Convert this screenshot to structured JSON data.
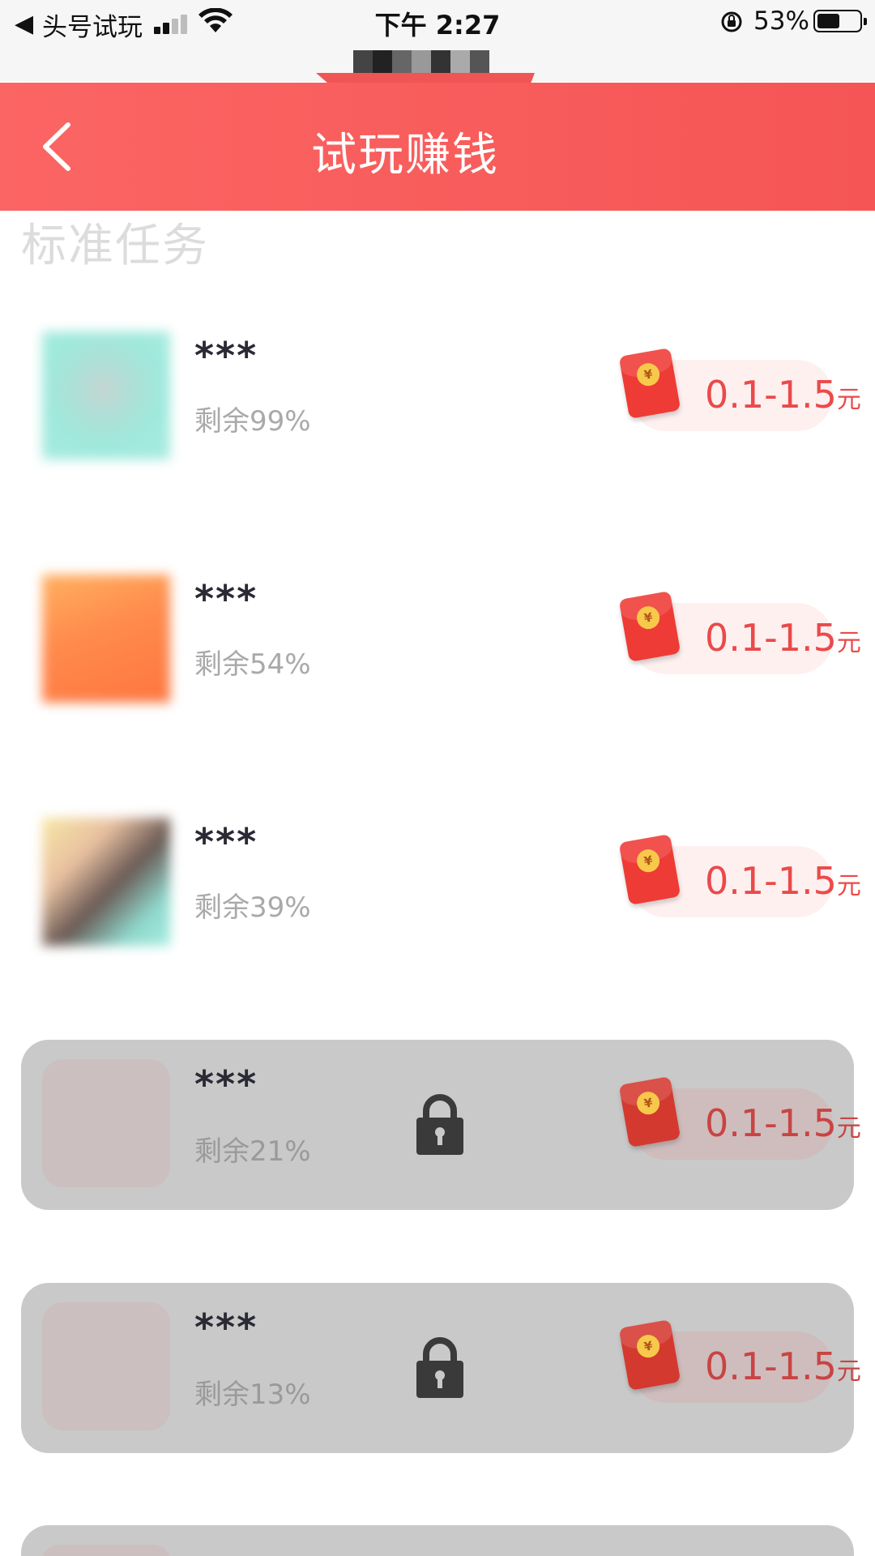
{
  "status_bar": {
    "back_glyph": "◀",
    "carrier": "头号试玩",
    "time": "下午 2:27",
    "battery_percent": "53%",
    "battery_level": 0.53,
    "icons": [
      "signal-icon",
      "wifi-icon",
      "orientation-lock-icon",
      "battery-icon"
    ]
  },
  "header": {
    "title": "试玩赚钱",
    "background": "#f55555",
    "back_icon": "chevron-left-icon"
  },
  "section": {
    "title": "标准任务"
  },
  "tasks": [
    {
      "name": "***",
      "remaining": "剩余99%",
      "reward": "0.1-1.5",
      "unit": "元",
      "locked": false,
      "thumb_colors": [
        "#9fe9dc",
        "#c8d4d0"
      ]
    },
    {
      "name": "***",
      "remaining": "剩余54%",
      "reward": "0.1-1.5",
      "unit": "元",
      "locked": false,
      "thumb_colors": [
        "#ff9a55",
        "#ff7b45"
      ]
    },
    {
      "name": "***",
      "remaining": "剩余39%",
      "reward": "0.1-1.5",
      "unit": "元",
      "locked": false,
      "thumb_colors": [
        "#f5e6a8",
        "#9ae8dc"
      ]
    },
    {
      "name": "***",
      "remaining": "剩余21%",
      "reward": "0.1-1.5",
      "unit": "元",
      "locked": true
    },
    {
      "name": "***",
      "remaining": "剩余13%",
      "reward": "0.1-1.5",
      "unit": "元",
      "locked": true
    }
  ],
  "colors": {
    "accent": "#f55555",
    "reward_text": "#ea4a4a",
    "locked_bg": "#c9c9c9"
  }
}
